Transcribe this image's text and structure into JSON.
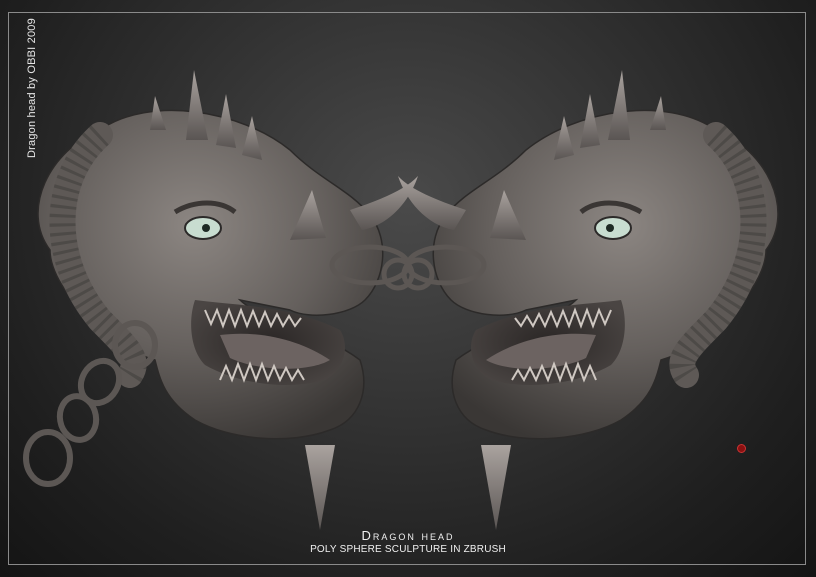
{
  "side_credit": "Dragon head by OBBI 2009",
  "title": "Dragon head",
  "subtitle": "POLY SPHERE SCULPTURE IN ZBRUSH",
  "colors": {
    "background": "#2a2a2a",
    "sculpt": "#6e6966",
    "eye": "#c8ddd0",
    "accent_dot": "#8a1111"
  }
}
